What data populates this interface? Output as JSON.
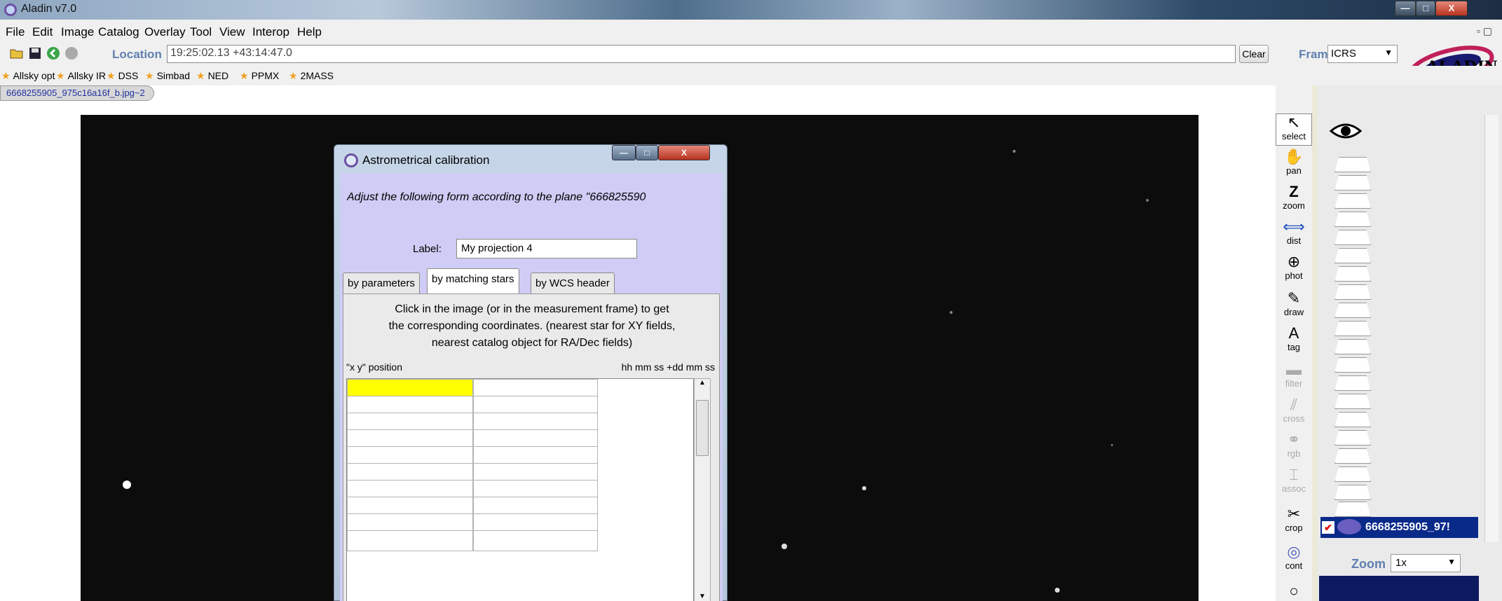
{
  "window": {
    "title": "Aladin v7.0"
  },
  "menubar": {
    "items": [
      "File",
      "Edit",
      "Image",
      "Catalog",
      "Overlay",
      "Tool",
      "View",
      "Interop",
      "Help"
    ]
  },
  "location": {
    "label": "Location",
    "value": "19:25:02.13 +43:14:47.0",
    "clear_label": "Clear"
  },
  "frame": {
    "label": "Frame",
    "value": "ICRS"
  },
  "bookmarks": [
    "Allsky opt",
    "Allsky IR",
    "DSS",
    "Simbad",
    "NED",
    "PPMX",
    "2MASS"
  ],
  "plane_tab": "6668255905_975c16a16f_b.jpg~2",
  "tools": [
    "select",
    "pan",
    "zoom",
    "dist",
    "phot",
    "draw",
    "tag",
    "filter",
    "cross",
    "rgb",
    "assoc",
    "crop",
    "cont"
  ],
  "stack": {
    "plane_name": "6668255905_97!",
    "zoom_label": "Zoom",
    "zoom_value": "1x"
  },
  "dialog": {
    "title": "Astrometrical calibration",
    "intro": "Adjust the following form according to the plane \"666825590",
    "label_caption": "Label:",
    "label_value": "My projection 4",
    "tabs": [
      "by parameters",
      "by matching stars",
      "by WCS header"
    ],
    "instructions_1": "Click in the image (or in the measurement frame) to get",
    "instructions_2": "the corresponding coordinates. (nearest star for XY fields,",
    "instructions_3": "nearest catalog object for RA/Dec fields)",
    "col_xy": "\"x y\" position",
    "col_radec": "hh mm ss +dd mm ss"
  },
  "colors": {
    "accent_label": "#6080b0",
    "selected_cell": "#ffff00",
    "dialog_body": "#cfccf5"
  }
}
